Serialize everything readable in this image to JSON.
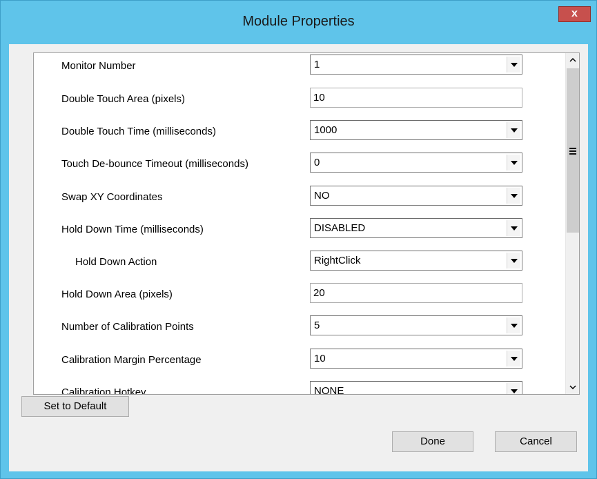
{
  "window": {
    "title": "Module Properties",
    "close_glyph": "x"
  },
  "properties": [
    {
      "label": "Monitor Number",
      "control": "combo",
      "value": "1"
    },
    {
      "label": "Double Touch Area (pixels)",
      "control": "text",
      "value": "10"
    },
    {
      "label": "Double Touch Time (milliseconds)",
      "control": "combo",
      "value": "1000"
    },
    {
      "label": "Touch De-bounce Timeout (milliseconds)",
      "control": "combo",
      "value": "0"
    },
    {
      "label": "Swap XY Coordinates",
      "control": "combo",
      "value": "NO"
    },
    {
      "label": "Hold Down Time (milliseconds)",
      "control": "combo",
      "value": "DISABLED"
    },
    {
      "label": "Hold Down Action",
      "control": "combo",
      "value": "RightClick",
      "indent": true
    },
    {
      "label": "Hold Down Area (pixels)",
      "control": "text",
      "value": "20"
    },
    {
      "label": "Number of Calibration Points",
      "control": "combo",
      "value": "5"
    },
    {
      "label": "Calibration Margin Percentage",
      "control": "combo",
      "value": "10"
    },
    {
      "label": "Calibration Hotkey",
      "control": "combo",
      "value": "NONE"
    }
  ],
  "buttons": {
    "set_default": "Set to Default",
    "done": "Done",
    "cancel": "Cancel"
  },
  "icons": {
    "close": "close-icon",
    "dropdown": "chevron-down-icon",
    "scroll_up": "scroll-up-arrow-icon",
    "scroll_down": "scroll-down-arrow-icon",
    "grip": "scroll-grip-icon"
  },
  "colors": {
    "title_bar": "#5fc4ea",
    "close_button": "#c7504d",
    "client_bg": "#f0f0f0"
  }
}
